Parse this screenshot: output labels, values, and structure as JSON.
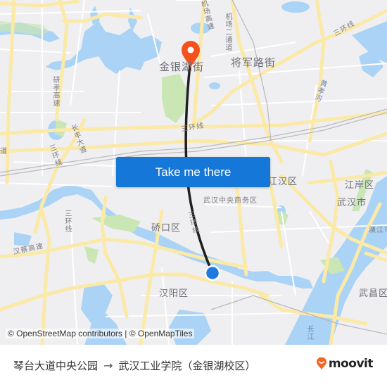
{
  "map": {
    "attribution": "© OpenStreetMap contributors | © OpenMapTiles",
    "labels": {
      "jinyinhu_jie": "金银湖街",
      "jiangjunlu_jie": "将军路街",
      "jichang_gaosu": "机场高速",
      "jichang_ertongdao": "机场二通道",
      "sanhuanxian_ne": "三环线",
      "yanxiao_gaosu": "研孝高速",
      "changfeng_dadao": "长丰大道",
      "sanhuanxian_w": "三环线",
      "dao_left": "道",
      "sanhuanxian_c": "三环线",
      "huangxiao_he": "黄孝河",
      "jianghan_qu": "江汉区",
      "jiangan_qu": "江岸区",
      "wuhan_shi": "武汉市",
      "wuhan_cbd": "武汉中央商务区",
      "qiaokou_qu": "硚口区",
      "sanhuanxian_sw": "三环线",
      "hancai_gaosu": "汉蔡高速",
      "sanhuanxian_c2": "三环线",
      "hanyang_qu": "汉阳区",
      "binjiang": "濱江市",
      "wuchang_qu": "武昌区",
      "changjiang": "长江"
    },
    "colors": {
      "land": "#efeff1",
      "water": "#aad3f5",
      "park": "#c9e6b4",
      "major_road": "#fbe9a8",
      "minor_road": "#ffffff",
      "route_line": "#1f1f1f",
      "origin_dot": "#1f7ae0",
      "destination_pin": "#f4511e"
    }
  },
  "cta": {
    "label": "Take me there",
    "color": "#1577d8"
  },
  "footer": {
    "origin": "琴台大道中央公园",
    "arrow": "→",
    "destination": "武汉工业学院（金银湖校区）",
    "brand": "moovit",
    "brand_color": "#f26522"
  }
}
